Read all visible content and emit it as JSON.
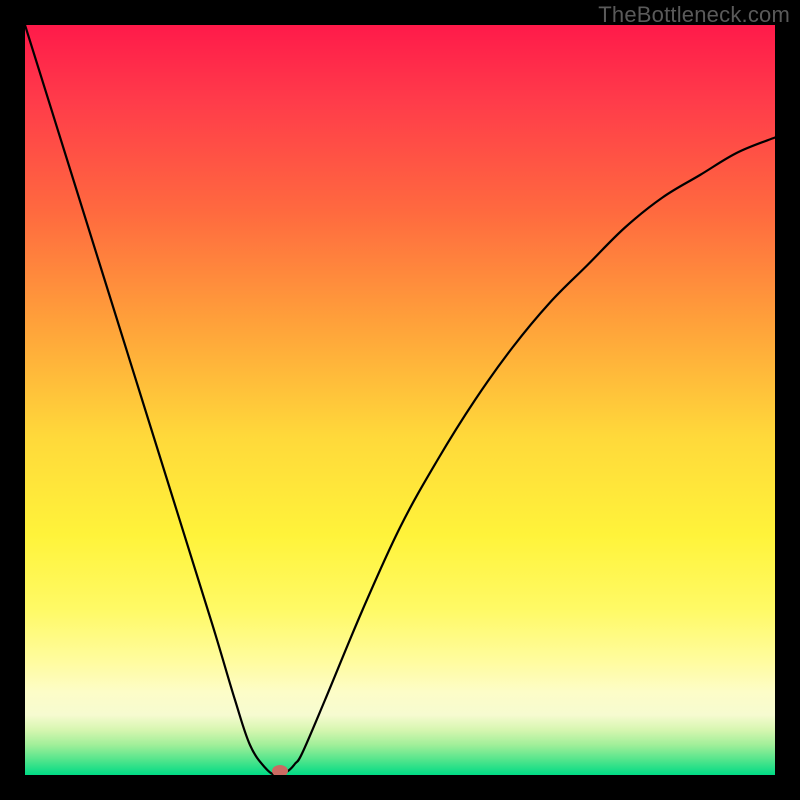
{
  "watermark": "TheBottleneck.com",
  "chart_data": {
    "type": "line",
    "title": "",
    "xlabel": "",
    "ylabel": "",
    "xlim": [
      0,
      100
    ],
    "ylim": [
      0,
      100
    ],
    "grid": false,
    "background": "rainbow-vertical-gradient",
    "series": [
      {
        "name": "bottleneck-curve",
        "x": [
          0,
          5,
          10,
          15,
          20,
          25,
          28,
          30,
          32,
          33.5,
          35,
          36,
          37,
          40,
          45,
          50,
          55,
          60,
          65,
          70,
          75,
          80,
          85,
          90,
          95,
          100
        ],
        "y": [
          100,
          84,
          68,
          52,
          36,
          20,
          10,
          4,
          1,
          0,
          0.5,
          1.5,
          3,
          10,
          22,
          33,
          42,
          50,
          57,
          63,
          68,
          73,
          77,
          80,
          83,
          85
        ]
      }
    ],
    "marker": {
      "x": 34,
      "y": 0,
      "color": "#cb6a62"
    }
  }
}
